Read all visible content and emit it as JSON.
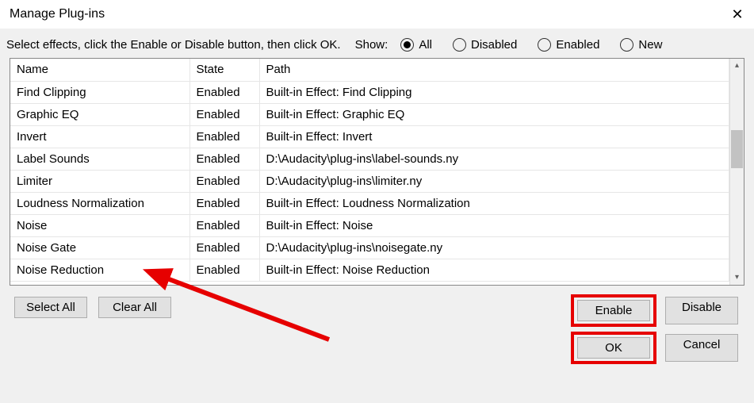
{
  "window": {
    "title": "Manage Plug-ins"
  },
  "instructions": "Select effects, click the Enable or Disable button, then click OK.",
  "show": {
    "label": "Show:",
    "options": [
      {
        "label": "All",
        "checked": true
      },
      {
        "label": "Disabled",
        "checked": false
      },
      {
        "label": "Enabled",
        "checked": false
      },
      {
        "label": "New",
        "checked": false
      }
    ]
  },
  "columns": {
    "name": "Name",
    "state": "State",
    "path": "Path"
  },
  "rows": [
    {
      "name": "Find Clipping",
      "state": "Enabled",
      "path": "Built-in Effect: Find Clipping"
    },
    {
      "name": "Graphic EQ",
      "state": "Enabled",
      "path": "Built-in Effect: Graphic EQ"
    },
    {
      "name": "Invert",
      "state": "Enabled",
      "path": "Built-in Effect: Invert"
    },
    {
      "name": "Label Sounds",
      "state": "Enabled",
      "path": "D:\\Audacity\\plug-ins\\label-sounds.ny"
    },
    {
      "name": "Limiter",
      "state": "Enabled",
      "path": "D:\\Audacity\\plug-ins\\limiter.ny"
    },
    {
      "name": "Loudness Normalization",
      "state": "Enabled",
      "path": "Built-in Effect: Loudness Normalization"
    },
    {
      "name": "Noise",
      "state": "Enabled",
      "path": "Built-in Effect: Noise"
    },
    {
      "name": "Noise Gate",
      "state": "Enabled",
      "path": "D:\\Audacity\\plug-ins\\noisegate.ny"
    },
    {
      "name": "Noise Reduction",
      "state": "Enabled",
      "path": "Built-in Effect: Noise Reduction"
    }
  ],
  "buttons": {
    "select_all": "Select All",
    "clear_all": "Clear All",
    "enable": "Enable",
    "disable": "Disable",
    "ok": "OK",
    "cancel": "Cancel"
  },
  "annotations": {
    "highlighted_buttons": [
      "enable",
      "ok"
    ],
    "arrow_target_row": "Noise Gate"
  }
}
